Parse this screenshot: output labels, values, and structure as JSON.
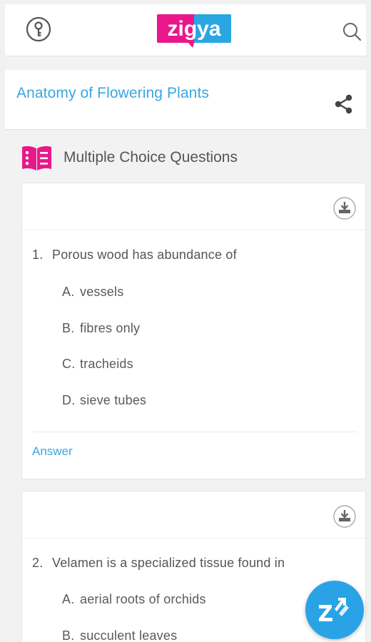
{
  "header": {
    "logo_text": "zigya",
    "key_icon": "key-icon",
    "search_icon": "search-icon"
  },
  "page": {
    "title": "Anatomy of Flowering Plants",
    "share_icon": "share-icon"
  },
  "section": {
    "icon": "mcq-list-icon",
    "title": "Multiple Choice Questions"
  },
  "questions": [
    {
      "number": "1.",
      "text": "Porous wood has abundance of",
      "options": [
        {
          "letter": "A.",
          "text": "vessels"
        },
        {
          "letter": "B.",
          "text": "fibres only"
        },
        {
          "letter": "C.",
          "text": "tracheids"
        },
        {
          "letter": "D.",
          "text": "sieve tubes"
        }
      ],
      "answer_label": "Answer"
    },
    {
      "number": "2.",
      "text": "Velamen is a specialized tissue found in",
      "options": [
        {
          "letter": "A.",
          "text": "aerial roots of orchids"
        },
        {
          "letter": "B.",
          "text": "succulent leaves"
        }
      ]
    }
  ],
  "colors": {
    "brand_pink": "#e8188a",
    "brand_blue": "#2aa6e2",
    "link_blue": "#3aa6e0",
    "fab_blue": "#29a3e6"
  }
}
